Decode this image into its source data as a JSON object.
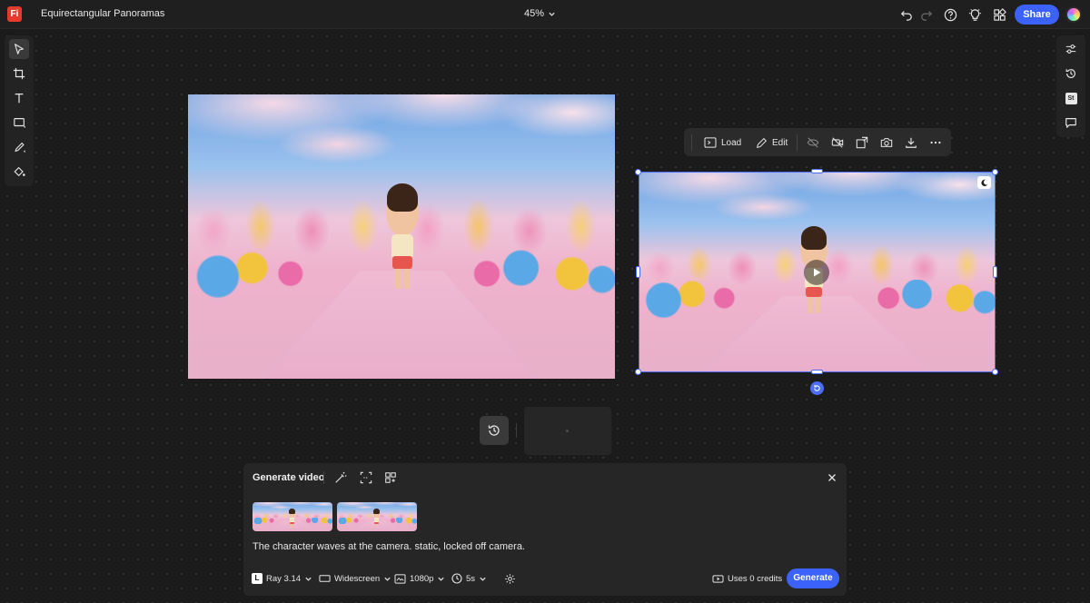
{
  "app": {
    "logo_text": "Fi",
    "document_title": "Equirectangular Panoramas",
    "zoom_level": "45%",
    "share_label": "Share",
    "accent_color": "#3b63fb"
  },
  "topbar_icons": [
    "undo-icon",
    "redo-icon",
    "help-icon",
    "lightbulb-icon",
    "apps-icon"
  ],
  "left_toolbar": [
    "select-tool",
    "artboard-tool",
    "text-tool",
    "shape-tool",
    "pen-tool",
    "fill-tool"
  ],
  "right_toolbar": {
    "items": [
      "adjust-icon",
      "history-icon",
      "stock-icon",
      "comment-icon"
    ],
    "stock_badge": "St"
  },
  "floating_toolbar": {
    "load_label": "Load",
    "edit_label": "Edit"
  },
  "gen_panel": {
    "title": "Generate video",
    "prompt": "The character waves at the camera. static, locked off camera.",
    "model_logo": "L",
    "model": "Ray 3.14",
    "aspect": "Widescreen",
    "resolution": "1080p",
    "duration": "5s",
    "credits": "Uses 0 credits",
    "generate_label": "Generate"
  }
}
